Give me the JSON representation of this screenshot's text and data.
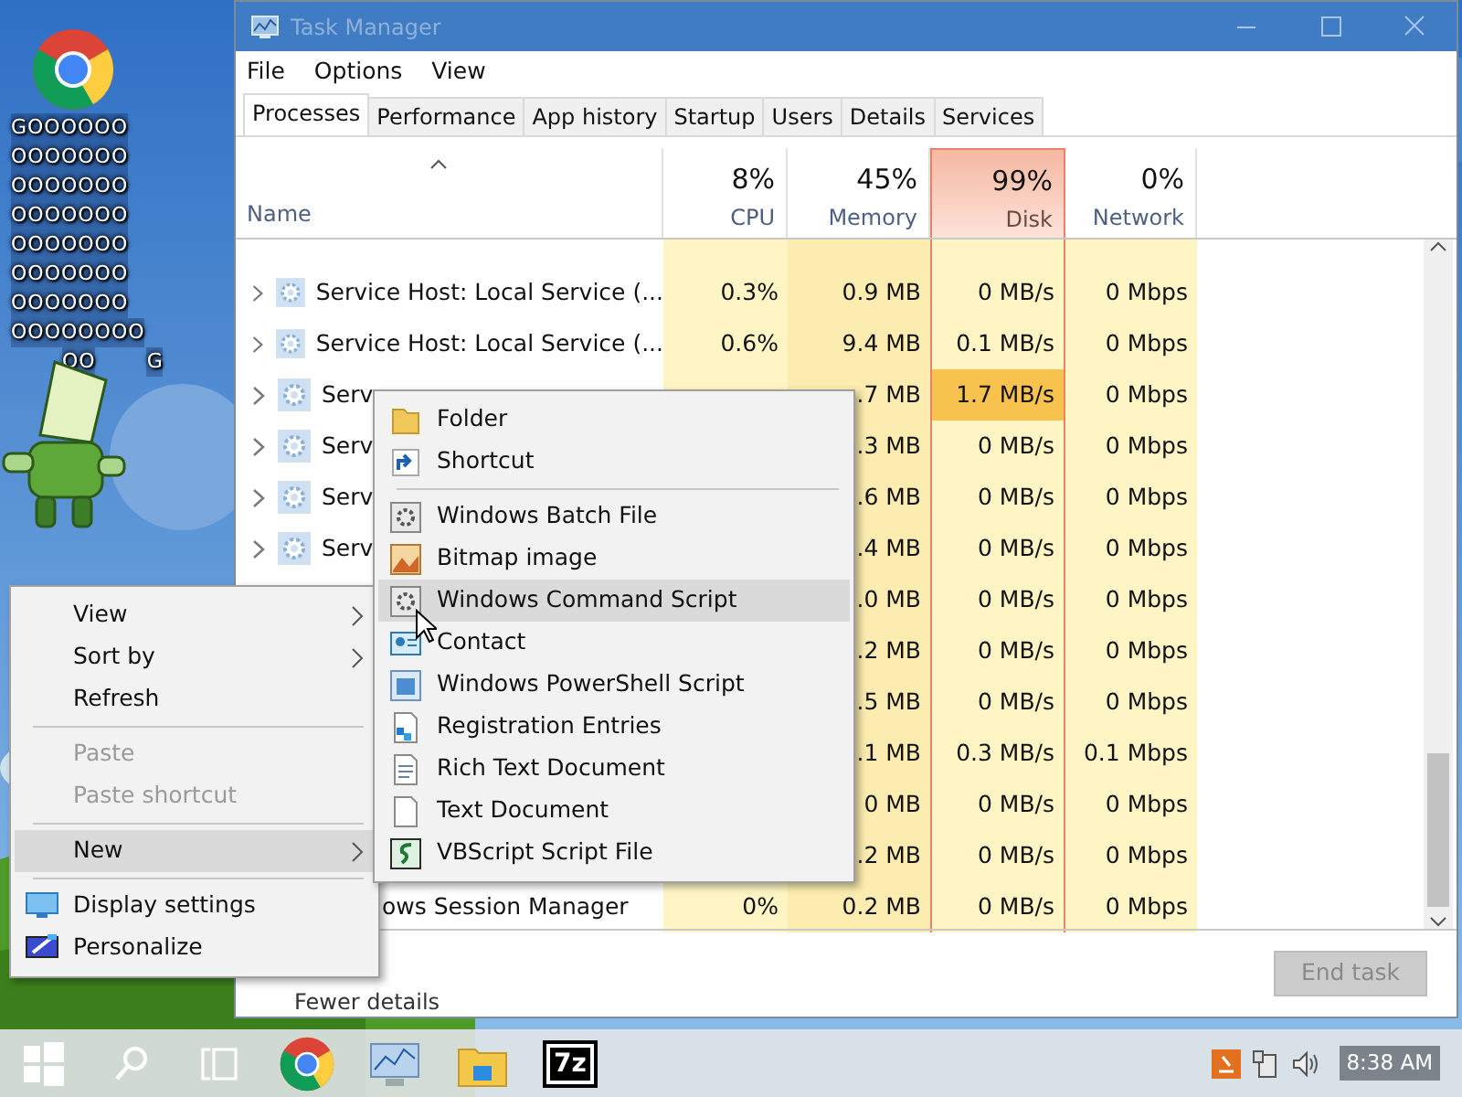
{
  "desktop": {
    "icon_label_lines": [
      "GOOOOOO",
      "OOOOOOO",
      "OOOOOOO",
      "OOOOOOO",
      "OOOOOOO",
      "OOOOOOO",
      "OOOOOOO",
      "OOOOOOOO"
    ],
    "icon_label_tail": [
      "OO",
      "G"
    ]
  },
  "task_manager": {
    "title": "Task Manager",
    "menu": [
      "File",
      "Options",
      "View"
    ],
    "tabs": [
      {
        "label": "Processes",
        "selected": true
      },
      {
        "label": "Performance",
        "selected": false
      },
      {
        "label": "App history",
        "selected": false
      },
      {
        "label": "Startup",
        "selected": false
      },
      {
        "label": "Users",
        "selected": false
      },
      {
        "label": "Details",
        "selected": false
      },
      {
        "label": "Services",
        "selected": false
      }
    ],
    "name_header": "Name",
    "columns": [
      {
        "percent": "8%",
        "label": "CPU",
        "selected": false
      },
      {
        "percent": "45%",
        "label": "Memory",
        "selected": false
      },
      {
        "percent": "99%",
        "label": "Disk",
        "selected": true
      },
      {
        "percent": "0%",
        "label": "Network",
        "selected": false
      }
    ],
    "rows": [
      {
        "expandable": true,
        "name": "Service Host: Local Service (...",
        "cpu": "0.3%",
        "memory": "0.9 MB",
        "disk": "0 MB/s",
        "network": "0 Mbps",
        "disk_active": false
      },
      {
        "expandable": true,
        "name": "Service Host: Local Service (...",
        "cpu": "0.6%",
        "memory": "9.4 MB",
        "disk": "0.1 MB/s",
        "network": "0 Mbps",
        "disk_active": false
      },
      {
        "expandable": true,
        "name": "Serv",
        "memory": ".7 MB",
        "disk": "1.7 MB/s",
        "network": "0 Mbps",
        "disk_active": true
      },
      {
        "expandable": true,
        "name": "Serv",
        "memory": ".3 MB",
        "disk": "0 MB/s",
        "network": "0 Mbps",
        "disk_active": false
      },
      {
        "expandable": true,
        "name": "Serv",
        "memory": ".6 MB",
        "disk": "0 MB/s",
        "network": "0 Mbps",
        "disk_active": false
      },
      {
        "expandable": true,
        "name": "Serv",
        "memory": ".4 MB",
        "disk": "0 MB/s",
        "network": "0 Mbps",
        "disk_active": false
      },
      {
        "memory": ".0 MB",
        "disk": "0 MB/s",
        "network": "0 Mbps",
        "disk_active": false
      },
      {
        "memory": ".2 MB",
        "disk": "0 MB/s",
        "network": "0 Mbps",
        "disk_active": false
      },
      {
        "memory": ".5 MB",
        "disk": "0 MB/s",
        "network": "0 Mbps",
        "disk_active": false
      },
      {
        "memory": ".1 MB",
        "disk": "0.3 MB/s",
        "network": "0.1 Mbps",
        "disk_active": false
      },
      {
        "memory": "0 MB",
        "disk": "0 MB/s",
        "network": "0 Mbps",
        "disk_active": false
      },
      {
        "memory": ".2 MB",
        "disk": "0 MB/s",
        "network": "0 Mbps",
        "disk_active": false
      },
      {
        "name": "ows Session Manager",
        "cpu": "0%",
        "memory": "0.2 MB",
        "disk": "0 MB/s",
        "network": "0 Mbps",
        "disk_active": false
      }
    ],
    "fewer_details": "Fewer details",
    "end_task": {
      "label": "End task",
      "disabled": true
    }
  },
  "context_menu": {
    "items": [
      {
        "kind": "item",
        "label": "View",
        "submenu": true,
        "disabled": false,
        "selected": false
      },
      {
        "kind": "item",
        "label": "Sort by",
        "submenu": true,
        "disabled": false,
        "selected": false
      },
      {
        "kind": "item",
        "label": "Refresh",
        "submenu": false,
        "disabled": false,
        "selected": false
      },
      {
        "kind": "separator"
      },
      {
        "kind": "item",
        "label": "Paste",
        "submenu": false,
        "disabled": true,
        "selected": false
      },
      {
        "kind": "item",
        "label": "Paste shortcut",
        "submenu": false,
        "disabled": true,
        "selected": false
      },
      {
        "kind": "separator"
      },
      {
        "kind": "item",
        "label": "New",
        "submenu": true,
        "disabled": false,
        "selected": true
      },
      {
        "kind": "separator"
      },
      {
        "kind": "item",
        "label": "Display settings",
        "submenu": false,
        "disabled": false,
        "selected": false
      },
      {
        "kind": "item",
        "label": "Personalize",
        "submenu": false,
        "disabled": false,
        "selected": false
      }
    ]
  },
  "new_submenu": {
    "items": [
      {
        "kind": "item",
        "label": "Folder",
        "selected": false
      },
      {
        "kind": "item",
        "label": "Shortcut",
        "selected": false
      },
      {
        "kind": "separator"
      },
      {
        "kind": "item",
        "label": "Windows Batch File",
        "selected": false
      },
      {
        "kind": "item",
        "label": "Bitmap image",
        "selected": false
      },
      {
        "kind": "item",
        "label": "Windows Command Script",
        "selected": true
      },
      {
        "kind": "item",
        "label": "Contact",
        "selected": false
      },
      {
        "kind": "item",
        "label": "Windows PowerShell Script",
        "selected": false
      },
      {
        "kind": "item",
        "label": "Registration Entries",
        "selected": false
      },
      {
        "kind": "item",
        "label": "Rich Text Document",
        "selected": false
      },
      {
        "kind": "item",
        "label": "Text Document",
        "selected": false
      },
      {
        "kind": "item",
        "label": "VBScript Script File",
        "selected": false
      }
    ]
  },
  "taskbar": {
    "app_label": "7z",
    "time": "8:38 AM"
  }
}
